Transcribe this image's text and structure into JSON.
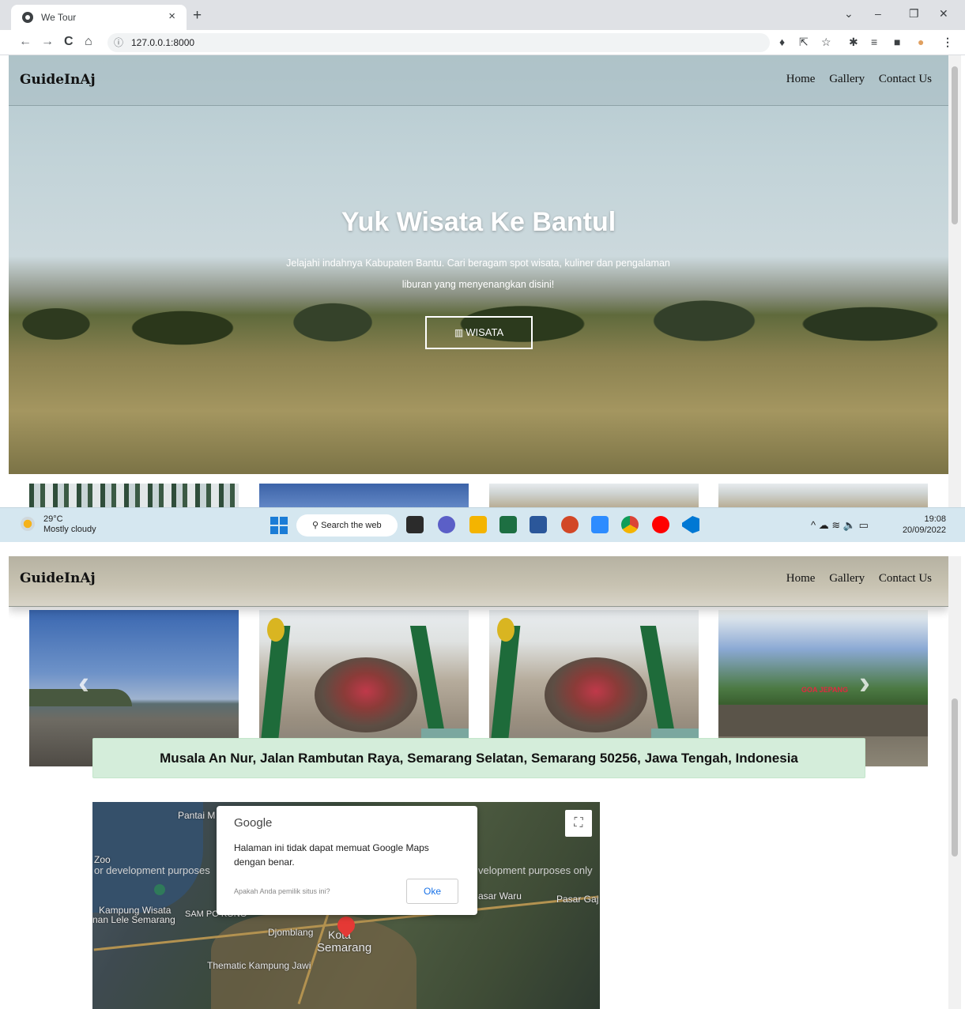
{
  "browser": {
    "tab_title": "We Tour",
    "tab_close": "×",
    "new_tab": "+",
    "url": "127.0.0.1:8000",
    "window_controls": [
      "⌄",
      "–",
      "❐",
      "✕"
    ],
    "nav_icons": [
      "arrow-back-icon",
      "arrow-forward-icon",
      "reload-icon",
      "home-icon"
    ],
    "ext_icons": [
      "location-icon",
      "share-icon",
      "star-icon",
      "puzzle-icon",
      "reading-list-icon",
      "sidepanel-icon",
      "avatar",
      "menu-icon"
    ]
  },
  "site": {
    "brand": "GuideInAj",
    "menu": [
      "Home",
      "Gallery",
      "Contact Us"
    ]
  },
  "hero": {
    "title": "Yuk Wisata Ke Bantul",
    "subtitle": "Jelajahi indahnya Kabupaten Bantu. Cari beragam spot wisata, kuliner dan pengalaman liburan yang menyenangkan disini!",
    "button": "WISATA",
    "button_icon": "map-icon"
  },
  "gallery": {
    "prev_icon": "‹",
    "next_icon": "›",
    "sign_text": "GOA JEPANG"
  },
  "address": "Musala An Nur, Jalan Rambutan Raya, Semarang Selatan, Semarang 50256, Jawa Tengah, Indonesia",
  "map": {
    "labels": {
      "pantai": "Pantai M",
      "zoo": "Zoo",
      "dev_left": "or development purposes",
      "dev_right": "velopment purposes only",
      "kampung": "Kampung Wisata",
      "lele": "nan Lele Semarang",
      "sam": "SAM PO KONG",
      "pasar_waru": "asar Waru",
      "pasar_gaj": "Pasar Gaj",
      "djomblang": "Djomblang",
      "kota": "Kota",
      "semarang": "Semarang",
      "thematic": "Thematic Kampung Jawi"
    },
    "dialog": {
      "brand": "Google",
      "message": "Halaman ini tidak dapat memuat Google Maps dengan benar.",
      "owner_question": "Apakah Anda pemilik situs ini?",
      "ok": "Oke"
    },
    "fullscreen_icon": "⛶"
  },
  "taskbar": {
    "temperature": "29°C",
    "condition": "Mostly cloudy",
    "search": "Search the web",
    "time": "19:08",
    "date": "20/09/2022",
    "apps": [
      "task-view-icon",
      "teams-icon",
      "file-explorer-icon",
      "excel-icon",
      "word-icon",
      "powerpoint-icon",
      "zoom-icon",
      "chrome-icon",
      "youtube-music-icon",
      "vscode-icon"
    ],
    "tray_icons": "^  ☁  ≋  🔈  ▭"
  }
}
